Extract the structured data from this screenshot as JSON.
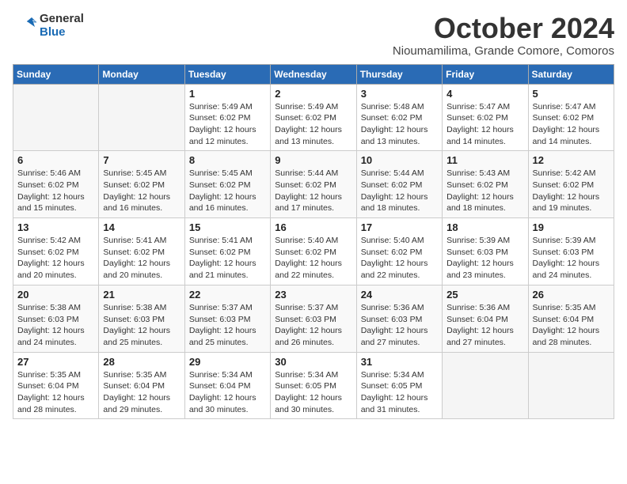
{
  "header": {
    "logo_general": "General",
    "logo_blue": "Blue",
    "month_title": "October 2024",
    "subtitle": "Nioumamilima, Grande Comore, Comoros"
  },
  "weekdays": [
    "Sunday",
    "Monday",
    "Tuesday",
    "Wednesday",
    "Thursday",
    "Friday",
    "Saturday"
  ],
  "weeks": [
    [
      {
        "day": "",
        "info": ""
      },
      {
        "day": "",
        "info": ""
      },
      {
        "day": "1",
        "info": "Sunrise: 5:49 AM\nSunset: 6:02 PM\nDaylight: 12 hours and 12 minutes."
      },
      {
        "day": "2",
        "info": "Sunrise: 5:49 AM\nSunset: 6:02 PM\nDaylight: 12 hours and 13 minutes."
      },
      {
        "day": "3",
        "info": "Sunrise: 5:48 AM\nSunset: 6:02 PM\nDaylight: 12 hours and 13 minutes."
      },
      {
        "day": "4",
        "info": "Sunrise: 5:47 AM\nSunset: 6:02 PM\nDaylight: 12 hours and 14 minutes."
      },
      {
        "day": "5",
        "info": "Sunrise: 5:47 AM\nSunset: 6:02 PM\nDaylight: 12 hours and 14 minutes."
      }
    ],
    [
      {
        "day": "6",
        "info": "Sunrise: 5:46 AM\nSunset: 6:02 PM\nDaylight: 12 hours and 15 minutes."
      },
      {
        "day": "7",
        "info": "Sunrise: 5:45 AM\nSunset: 6:02 PM\nDaylight: 12 hours and 16 minutes."
      },
      {
        "day": "8",
        "info": "Sunrise: 5:45 AM\nSunset: 6:02 PM\nDaylight: 12 hours and 16 minutes."
      },
      {
        "day": "9",
        "info": "Sunrise: 5:44 AM\nSunset: 6:02 PM\nDaylight: 12 hours and 17 minutes."
      },
      {
        "day": "10",
        "info": "Sunrise: 5:44 AM\nSunset: 6:02 PM\nDaylight: 12 hours and 18 minutes."
      },
      {
        "day": "11",
        "info": "Sunrise: 5:43 AM\nSunset: 6:02 PM\nDaylight: 12 hours and 18 minutes."
      },
      {
        "day": "12",
        "info": "Sunrise: 5:42 AM\nSunset: 6:02 PM\nDaylight: 12 hours and 19 minutes."
      }
    ],
    [
      {
        "day": "13",
        "info": "Sunrise: 5:42 AM\nSunset: 6:02 PM\nDaylight: 12 hours and 20 minutes."
      },
      {
        "day": "14",
        "info": "Sunrise: 5:41 AM\nSunset: 6:02 PM\nDaylight: 12 hours and 20 minutes."
      },
      {
        "day": "15",
        "info": "Sunrise: 5:41 AM\nSunset: 6:02 PM\nDaylight: 12 hours and 21 minutes."
      },
      {
        "day": "16",
        "info": "Sunrise: 5:40 AM\nSunset: 6:02 PM\nDaylight: 12 hours and 22 minutes."
      },
      {
        "day": "17",
        "info": "Sunrise: 5:40 AM\nSunset: 6:02 PM\nDaylight: 12 hours and 22 minutes."
      },
      {
        "day": "18",
        "info": "Sunrise: 5:39 AM\nSunset: 6:03 PM\nDaylight: 12 hours and 23 minutes."
      },
      {
        "day": "19",
        "info": "Sunrise: 5:39 AM\nSunset: 6:03 PM\nDaylight: 12 hours and 24 minutes."
      }
    ],
    [
      {
        "day": "20",
        "info": "Sunrise: 5:38 AM\nSunset: 6:03 PM\nDaylight: 12 hours and 24 minutes."
      },
      {
        "day": "21",
        "info": "Sunrise: 5:38 AM\nSunset: 6:03 PM\nDaylight: 12 hours and 25 minutes."
      },
      {
        "day": "22",
        "info": "Sunrise: 5:37 AM\nSunset: 6:03 PM\nDaylight: 12 hours and 25 minutes."
      },
      {
        "day": "23",
        "info": "Sunrise: 5:37 AM\nSunset: 6:03 PM\nDaylight: 12 hours and 26 minutes."
      },
      {
        "day": "24",
        "info": "Sunrise: 5:36 AM\nSunset: 6:03 PM\nDaylight: 12 hours and 27 minutes."
      },
      {
        "day": "25",
        "info": "Sunrise: 5:36 AM\nSunset: 6:04 PM\nDaylight: 12 hours and 27 minutes."
      },
      {
        "day": "26",
        "info": "Sunrise: 5:35 AM\nSunset: 6:04 PM\nDaylight: 12 hours and 28 minutes."
      }
    ],
    [
      {
        "day": "27",
        "info": "Sunrise: 5:35 AM\nSunset: 6:04 PM\nDaylight: 12 hours and 28 minutes."
      },
      {
        "day": "28",
        "info": "Sunrise: 5:35 AM\nSunset: 6:04 PM\nDaylight: 12 hours and 29 minutes."
      },
      {
        "day": "29",
        "info": "Sunrise: 5:34 AM\nSunset: 6:04 PM\nDaylight: 12 hours and 30 minutes."
      },
      {
        "day": "30",
        "info": "Sunrise: 5:34 AM\nSunset: 6:05 PM\nDaylight: 12 hours and 30 minutes."
      },
      {
        "day": "31",
        "info": "Sunrise: 5:34 AM\nSunset: 6:05 PM\nDaylight: 12 hours and 31 minutes."
      },
      {
        "day": "",
        "info": ""
      },
      {
        "day": "",
        "info": ""
      }
    ]
  ]
}
